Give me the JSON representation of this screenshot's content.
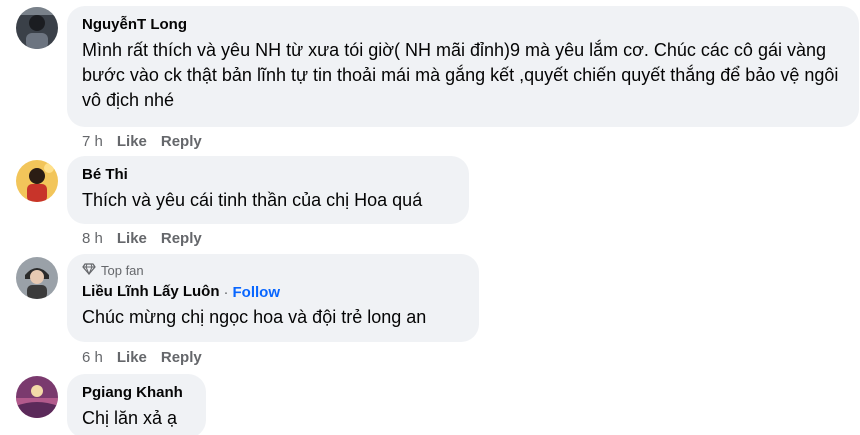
{
  "comments": [
    {
      "author": "NguyễnT Long",
      "text": "Mình rất thích và yêu NH từ xưa tói giờ( NH mãi đỉnh)9 mà yêu lắm cơ. Chúc các cô gái vàng bước vào ck thật bản lĩnh tự tin thoải mái mà gắng kết ,quyết chiến quyết thắng để bảo vệ ngôi vô địch nhé",
      "time": "7 h",
      "like": "Like",
      "reply": "Reply"
    },
    {
      "author": "Bé Thi",
      "text": "Thích và yêu cái tinh thần của chị Hoa quá",
      "time": "8 h",
      "like": "Like",
      "reply": "Reply"
    },
    {
      "badge": "Top fan",
      "author": "Liều Lĩnh Lấy Luôn",
      "separator": "·",
      "follow": "Follow",
      "text": "Chúc mừng chị ngọc hoa và đội trẻ long an",
      "time": "6 h",
      "like": "Like",
      "reply": "Reply"
    },
    {
      "author": "Pgiang Khanh",
      "text": "Chị lăn xả ạ"
    }
  ],
  "colors": {
    "bubble": "#f0f2f5",
    "secondary_text": "#65676b",
    "link": "#0866ff"
  },
  "icons": [
    "diamond-icon"
  ]
}
